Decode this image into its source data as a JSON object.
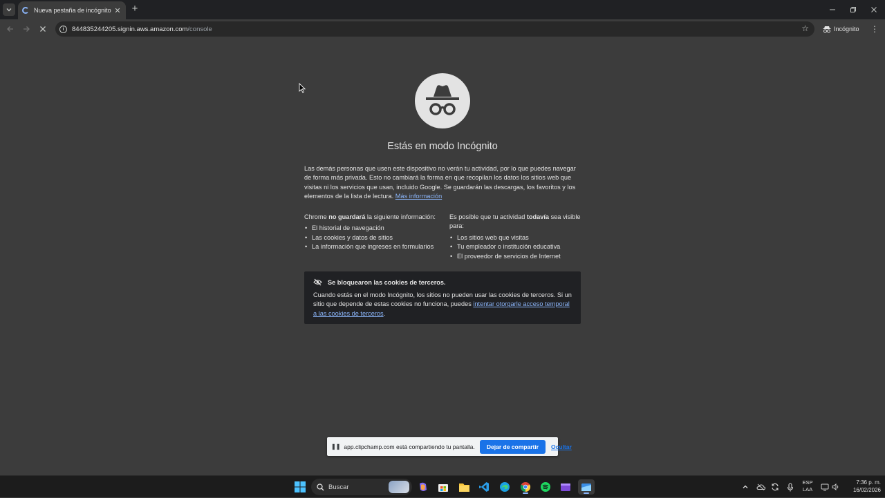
{
  "browser": {
    "tab_title": "Nueva pestaña de incógnito",
    "url_host": "844835244205.signin.aws.amazon.com",
    "url_path": "/console",
    "profile_label": "Incógnito"
  },
  "page": {
    "heading": "Estás en modo Incógnito",
    "intro": "Las demás personas que usen este dispositivo no verán tu actividad, por lo que puedes navegar de forma más privada. Esto no cambiará la forma en que recopilan los datos los sitios web que visitas ni los servicios que usan, incluido Google. Se guardarán las descargas, los favoritos y los elementos de la lista de lectura.",
    "learn_more": "Más información",
    "left_col": {
      "prefix": "Chrome ",
      "bold": "no guardará",
      "suffix": " la siguiente información:",
      "items": [
        "El historial de navegación",
        "Las cookies y datos de sitios",
        "La información que ingreses en formularios"
      ]
    },
    "right_col": {
      "prefix": "Es posible que tu actividad ",
      "bold": "todavía",
      "suffix": " sea visible para:",
      "items": [
        "Los sitios web que visitas",
        "Tu empleador o institución educativa",
        "El proveedor de servicios de Internet"
      ]
    },
    "cookie_card": {
      "title": "Se bloquearon las cookies de terceros.",
      "body": "Cuando estás en el modo Incógnito, los sitios no pueden usar las cookies de terceros. Si un sitio que depende de estas cookies no funciona, puedes ",
      "link": "intentar otorgarle acceso temporal a las cookies de terceros",
      "tail": "."
    }
  },
  "share_bar": {
    "message": "app.clipchamp.com está compartiendo tu pantalla.",
    "stop_label": "Dejar de compartir",
    "hide_label": "Ocultar"
  },
  "taskbar": {
    "search_placeholder": "Buscar",
    "lang_top": "ESP",
    "lang_bottom": "LAA",
    "time": "7:36 p. m.",
    "date": "16/02/2026"
  },
  "colors": {
    "accent": "#8ab4f8",
    "share_button": "#1a73e8",
    "page_bg": "#3c3c3c",
    "card_bg": "#202124"
  }
}
